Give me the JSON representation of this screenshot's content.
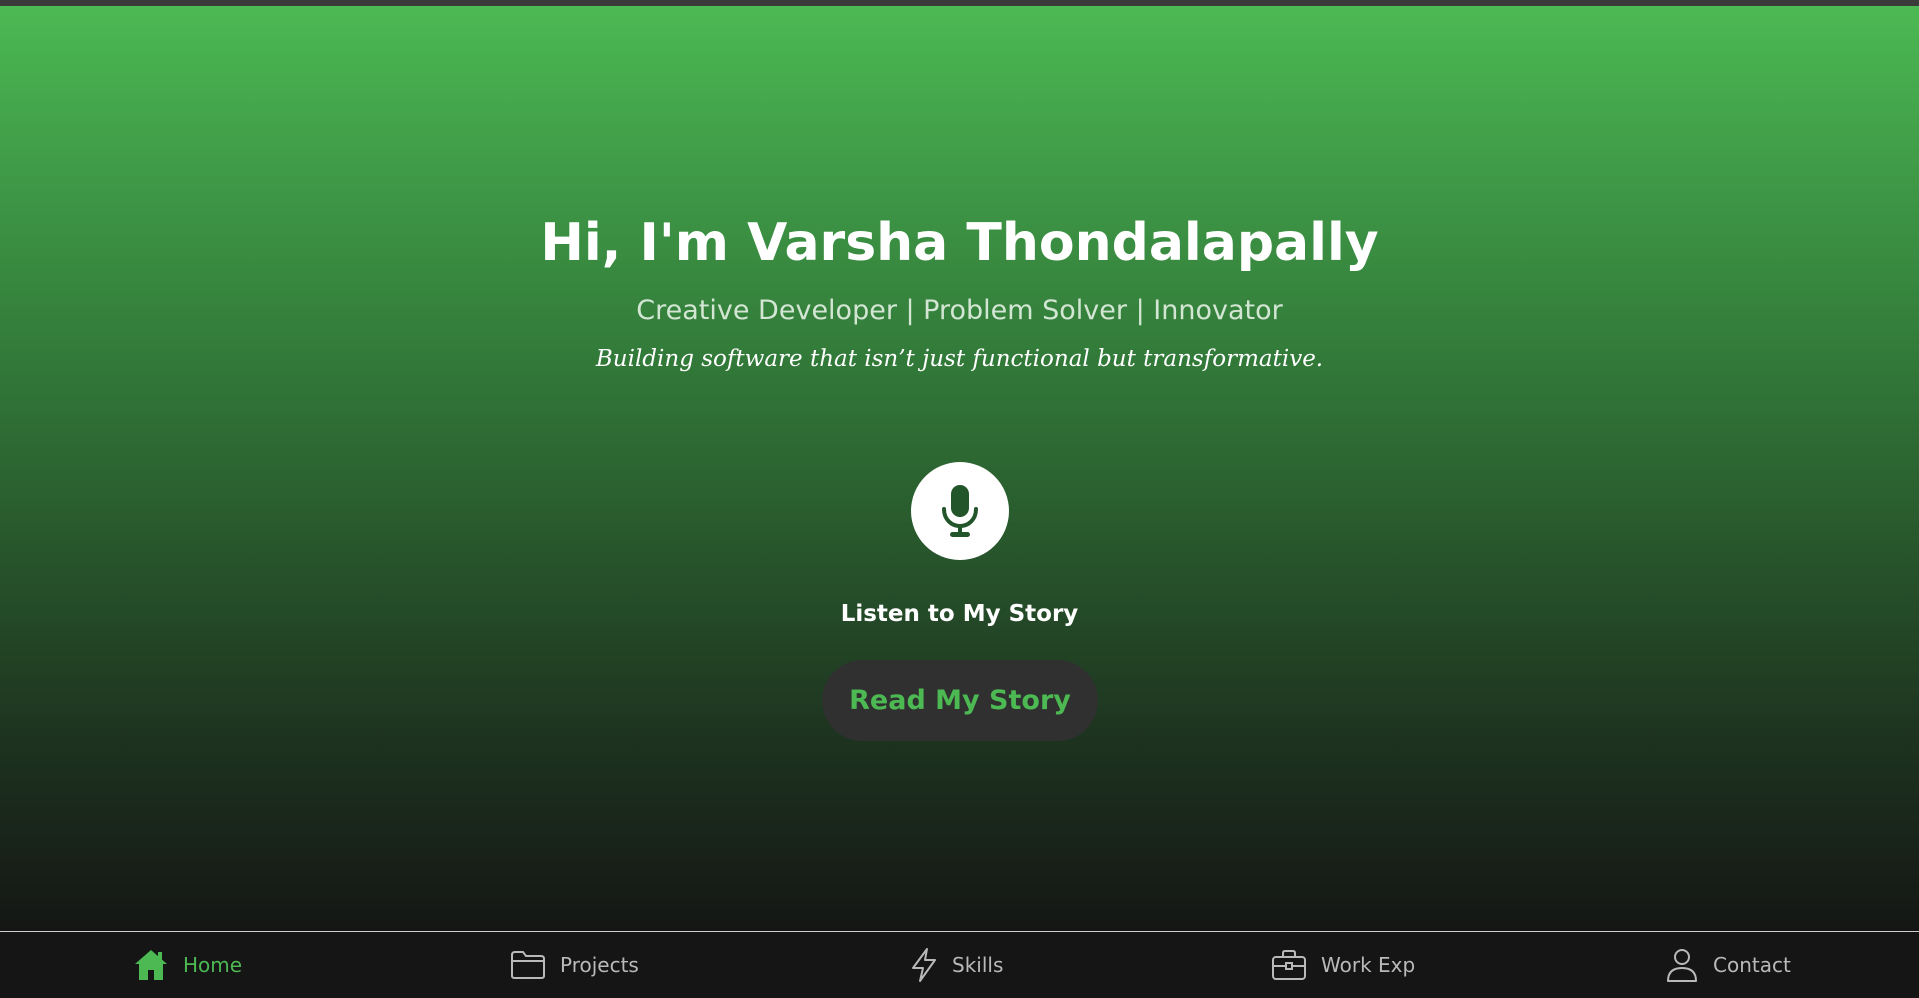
{
  "hero": {
    "title": "Hi, I'm Varsha Thondalapally",
    "subtitle": "Creative Developer | Problem Solver | Innovator",
    "tagline": "Building software that isn’t just functional but transformative.",
    "mic_icon": "microphone-icon",
    "listen_label": "Listen to My Story",
    "read_button_label": "Read My Story"
  },
  "nav": {
    "items": [
      {
        "label": "Home",
        "icon": "home-icon",
        "active": true
      },
      {
        "label": "Projects",
        "icon": "folder-icon",
        "active": false
      },
      {
        "label": "Skills",
        "icon": "lightning-icon",
        "active": false
      },
      {
        "label": "Work Exp",
        "icon": "briefcase-icon",
        "active": false
      },
      {
        "label": "Contact",
        "icon": "user-icon",
        "active": false
      }
    ]
  },
  "colors": {
    "accent": "#4cb953",
    "hero_top": "#4cb953",
    "hero_bottom": "#141614",
    "nav_background": "#151515",
    "nav_text": "#b9b9b9",
    "button_background": "#303030"
  }
}
